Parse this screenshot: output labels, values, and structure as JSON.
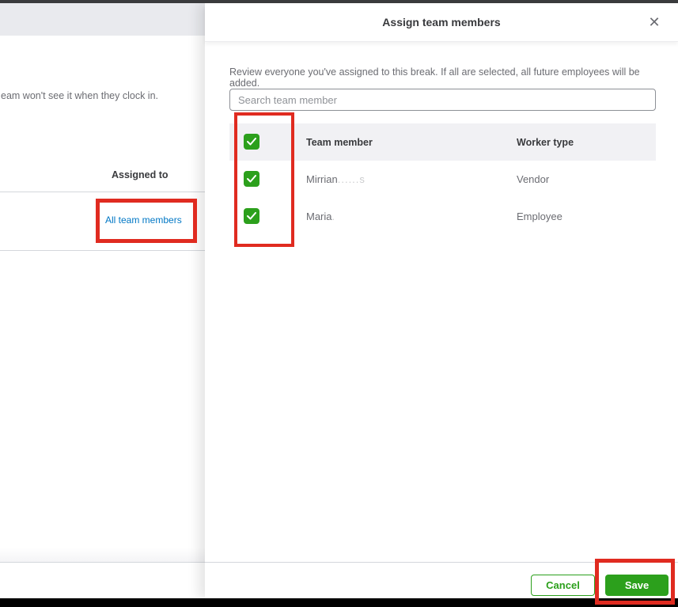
{
  "colors": {
    "accent_green": "#2ca01c",
    "link_blue": "#0077c5",
    "annotation_red": "#e02b20",
    "top_bar": "#3a3b3d",
    "table_header_bg": "#f1f1f4"
  },
  "background_page": {
    "clipped_text": "eam won't see it when they clock in.",
    "assigned_to_header": "Assigned to",
    "all_team_members_link": "All team members"
  },
  "modal": {
    "title": "Assign team members",
    "close_icon": "✕",
    "description": "Review everyone you've assigned to this break. If all are selected, all future employees will be added.",
    "search": {
      "placeholder": "Search team member",
      "value": ""
    },
    "table": {
      "columns": {
        "member": "Team member",
        "worker_type": "Worker type"
      },
      "select_all_checked": true,
      "rows": [
        {
          "name": "Mirrian",
          "name_redacted": "......s",
          "worker_type": "Vendor",
          "checked": true
        },
        {
          "name": "Maria",
          "name_redacted": ".",
          "worker_type": "Employee",
          "checked": true
        }
      ]
    },
    "footer": {
      "cancel_label": "Cancel",
      "save_label": "Save"
    }
  }
}
